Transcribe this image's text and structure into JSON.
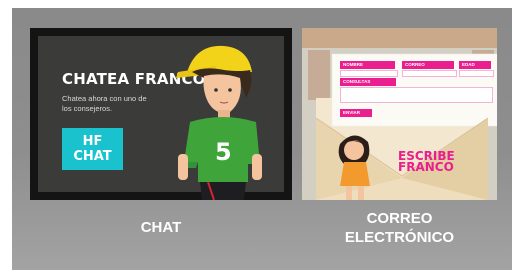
{
  "chat_card": {
    "title": "CHATEA FRANCO",
    "description": "Chatea ahora con uno de los consejeros.",
    "button_label": "HF CHAT",
    "shirt_number": "5",
    "caption": "CHAT"
  },
  "mail_card": {
    "form": {
      "name_label": "NOMBRE",
      "email_label": "CORREO",
      "age_label": "EDAD",
      "queries_label": "CONSULTAS",
      "send_label": "ENVIAR"
    },
    "tagline_line1": "ESCRIBE",
    "tagline_line2": "FRANCO",
    "caption_line1": "CORREO",
    "caption_line2": "ELECTRÓNICO"
  },
  "colors": {
    "accent_pink": "#ea1e8e",
    "accent_cyan": "#19c2cc",
    "panel_gray": "#8e8e8e"
  }
}
